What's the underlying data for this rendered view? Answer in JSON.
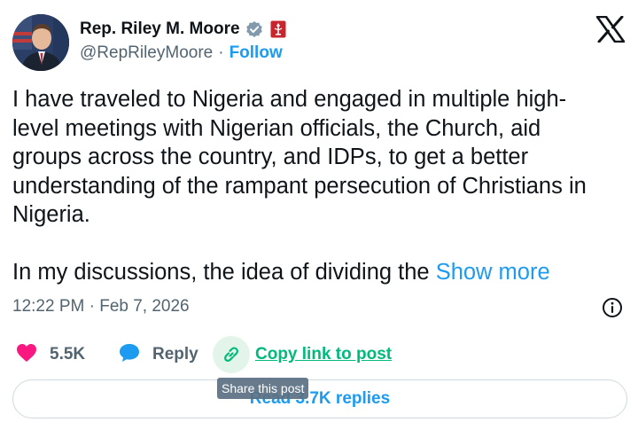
{
  "author": {
    "display_name": "Rep. Riley M. Moore",
    "handle": "@RepRileyMoore",
    "separator": "·",
    "follow_label": "Follow"
  },
  "icons": {
    "verified": "verified-badge-icon",
    "affiliation": "us-house-seal-icon",
    "logo": "x-logo-icon",
    "info": "info-icon",
    "like": "heart-icon",
    "reply": "speech-bubble-icon",
    "copy": "link-icon"
  },
  "colors": {
    "accent": "#1d9bf0",
    "like": "#f91880",
    "copy": "#00ba7c",
    "muted": "#536471"
  },
  "tweet": {
    "paragraph1": "I have traveled to Nigeria and engaged in multiple high-level meetings with Nigerian officials, the Church, aid groups across the country, and IDPs, to get a better understanding of the rampant persecution of Christians in Nigeria.",
    "paragraph2": "In my discussions, the idea of dividing the ",
    "show_more": "Show more",
    "timestamp": "12:22 PM · Feb 7, 2026"
  },
  "actions": {
    "like_count": "5.5K",
    "reply_label": "Reply",
    "copy_label": "Copy link to post",
    "read_replies": "Read 3.7K replies",
    "tooltip": "Share this post"
  }
}
